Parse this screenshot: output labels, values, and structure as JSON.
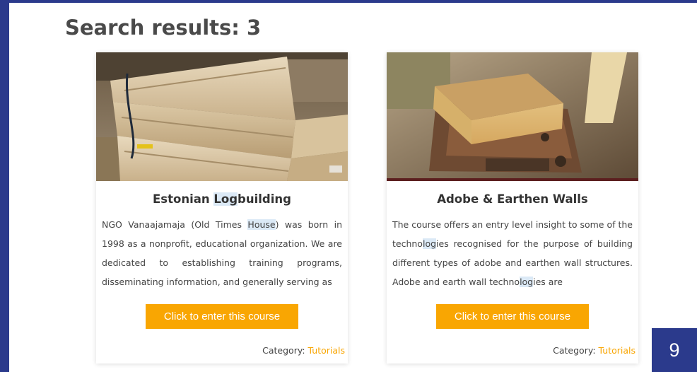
{
  "header": {
    "title": "Search results: 3"
  },
  "cards": [
    {
      "title_pre": "Estonian ",
      "title_hl": "Log",
      "title_post": "building",
      "desc_1": "NGO Vanaajamaja (Old Times ",
      "desc_hl": "House",
      "desc_2": ") was born in 1998 as a nonprofit, educational organization. We are dedicated to establishing training programs, disseminating information, and generally serving as",
      "button_label": "Click to enter this course",
      "category_label": "Category:",
      "category_link": "Tutorials"
    },
    {
      "title": "Adobe & Earthen Walls",
      "desc_1": "The course offers an entry level insight to some of the techno",
      "desc_hl1": "log",
      "desc_2": "ies recognised for the purpose of building different types of adobe and earthen wall structures. Adobe and earth wall techno",
      "desc_hl2": "log",
      "desc_3": "ies are",
      "button_label": "Click to enter this course",
      "category_label": "Category:",
      "category_link": "Tutorials"
    }
  ],
  "page_number": "9",
  "colors": {
    "frame": "#2b3a8c",
    "accent": "#f9a602",
    "highlight": "#dbe9f6"
  }
}
